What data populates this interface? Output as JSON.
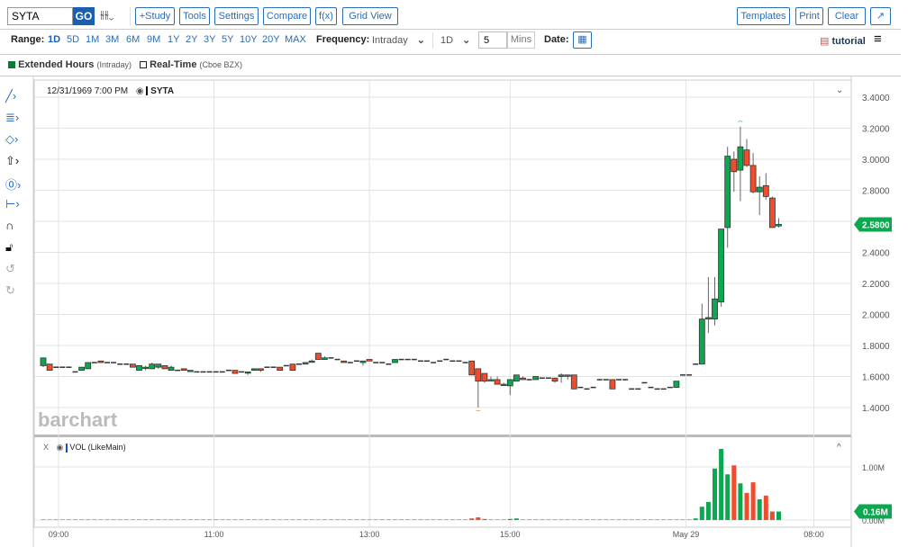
{
  "toolbar": {
    "symbol": "SYTA",
    "go": "GO",
    "buttons": [
      "+Study",
      "Tools",
      "Settings",
      "Compare",
      "f(x)",
      "Grid View"
    ],
    "right_buttons": [
      "Templates",
      "Print",
      "Clear"
    ]
  },
  "range": {
    "label": "Range:",
    "options": [
      "1D",
      "5D",
      "1M",
      "3M",
      "6M",
      "9M",
      "1Y",
      "2Y",
      "3Y",
      "5Y",
      "10Y",
      "20Y",
      "MAX"
    ],
    "selected": "1D"
  },
  "frequency": {
    "label": "Frequency:",
    "value": "Intraday",
    "period": "1D",
    "interval": "5",
    "unit": "Mins"
  },
  "date": {
    "label": "Date:"
  },
  "tutorial": "tutorial",
  "legend": {
    "extended": "Extended Hours",
    "extended_note": "(Intraday)",
    "realtime": "Real-Time",
    "realtime_note": "(Cboe BZX)"
  },
  "chart_header": {
    "datetime": "12/31/1969 7:00 PM",
    "symbol": "SYTA"
  },
  "volume_header": {
    "close": "X",
    "label": "VOL (LikeMain)"
  },
  "watermark": "barchart",
  "colors": {
    "up": "#0aa84f",
    "down": "#ef4d2d",
    "accent": "#2a6db8"
  },
  "chart_data": {
    "type": "candlestick",
    "ylim": [
      1.4,
      3.4
    ],
    "yticks": [
      "3.4000",
      "3.2000",
      "3.0000",
      "2.8000",
      "2.6000",
      "2.4000",
      "2.2000",
      "2.0000",
      "1.8000",
      "1.6000",
      "1.4000"
    ],
    "last_price": "2.5800",
    "last_price_value": 2.58,
    "volume_ticks": [
      "1.00M",
      "0.00M"
    ],
    "last_volume": "0.16M",
    "last_volume_value": 0.16,
    "xticks": [
      {
        "label": "09:00",
        "bar": 2.4
      },
      {
        "label": "11:00",
        "bar": 26.7
      },
      {
        "label": "13:00",
        "bar": 51
      },
      {
        "label": "15:00",
        "bar": 73
      },
      {
        "label": "May 29",
        "bar": 100.5
      },
      {
        "label": "08:00",
        "bar": 120.5
      }
    ],
    "candles": [
      [
        1.67,
        1.72,
        1.66,
        1.72,
        0.01
      ],
      [
        1.68,
        1.68,
        1.64,
        1.64,
        0.01
      ],
      [
        1.66,
        1.66,
        1.66,
        1.66,
        0.002
      ],
      [
        1.66,
        1.66,
        1.66,
        1.66,
        0.002
      ],
      [
        1.66,
        1.66,
        1.66,
        1.66,
        0.002
      ],
      [
        1.63,
        1.63,
        1.63,
        1.63,
        0.002
      ],
      [
        1.64,
        1.66,
        1.64,
        1.66,
        0.005
      ],
      [
        1.65,
        1.69,
        1.65,
        1.69,
        0.01
      ],
      [
        1.69,
        1.69,
        1.69,
        1.69,
        0.003
      ],
      [
        1.7,
        1.7,
        1.69,
        1.69,
        0.003
      ],
      [
        1.69,
        1.69,
        1.69,
        1.69,
        0.002
      ],
      [
        1.69,
        1.69,
        1.69,
        1.69,
        0.002
      ],
      [
        1.68,
        1.68,
        1.68,
        1.68,
        0.002
      ],
      [
        1.68,
        1.68,
        1.68,
        1.68,
        0.002
      ],
      [
        1.68,
        1.68,
        1.66,
        1.66,
        0.01
      ],
      [
        1.64,
        1.67,
        1.64,
        1.67,
        0.01
      ],
      [
        1.66,
        1.67,
        1.64,
        1.66,
        0.005
      ],
      [
        1.65,
        1.69,
        1.65,
        1.68,
        0.01
      ],
      [
        1.66,
        1.68,
        1.65,
        1.68,
        0.005
      ],
      [
        1.67,
        1.67,
        1.65,
        1.65,
        0.01
      ],
      [
        1.64,
        1.67,
        1.64,
        1.66,
        0.01
      ],
      [
        1.64,
        1.64,
        1.64,
        1.64,
        0.002
      ],
      [
        1.65,
        1.65,
        1.64,
        1.64,
        0.005
      ],
      [
        1.64,
        1.64,
        1.63,
        1.64,
        0.002
      ],
      [
        1.63,
        1.63,
        1.63,
        1.63,
        0.002
      ],
      [
        1.63,
        1.63,
        1.63,
        1.63,
        0.002
      ],
      [
        1.63,
        1.63,
        1.63,
        1.63,
        0.002
      ],
      [
        1.63,
        1.63,
        1.63,
        1.63,
        0.002
      ],
      [
        1.63,
        1.63,
        1.63,
        1.63,
        0.002
      ],
      [
        1.64,
        1.64,
        1.64,
        1.64,
        0.002
      ],
      [
        1.64,
        1.64,
        1.62,
        1.62,
        0.005
      ],
      [
        1.63,
        1.63,
        1.63,
        1.63,
        0.002
      ],
      [
        1.63,
        1.63,
        1.61,
        1.63,
        0.002
      ],
      [
        1.64,
        1.65,
        1.64,
        1.65,
        0.005
      ],
      [
        1.65,
        1.65,
        1.63,
        1.64,
        0.005
      ],
      [
        1.66,
        1.66,
        1.66,
        1.66,
        0.002
      ],
      [
        1.66,
        1.66,
        1.66,
        1.66,
        0.002
      ],
      [
        1.66,
        1.66,
        1.64,
        1.64,
        0.005
      ],
      [
        1.67,
        1.67,
        1.67,
        1.67,
        0.002
      ],
      [
        1.68,
        1.68,
        1.64,
        1.64,
        0.01
      ],
      [
        1.68,
        1.68,
        1.68,
        1.68,
        0.002
      ],
      [
        1.68,
        1.69,
        1.68,
        1.69,
        0.005
      ],
      [
        1.7,
        1.71,
        1.69,
        1.7,
        0.005
      ],
      [
        1.75,
        1.75,
        1.71,
        1.71,
        0.01
      ],
      [
        1.71,
        1.73,
        1.71,
        1.72,
        0.005
      ],
      [
        1.72,
        1.72,
        1.72,
        1.72,
        0.002
      ],
      [
        1.71,
        1.71,
        1.71,
        1.71,
        0.002
      ],
      [
        1.7,
        1.7,
        1.69,
        1.69,
        0.005
      ],
      [
        1.69,
        1.69,
        1.69,
        1.69,
        0.002
      ],
      [
        1.7,
        1.7,
        1.7,
        1.7,
        0.002
      ],
      [
        1.69,
        1.7,
        1.67,
        1.7,
        0.005
      ],
      [
        1.71,
        1.71,
        1.7,
        1.7,
        0.005
      ],
      [
        1.69,
        1.69,
        1.69,
        1.69,
        0.002
      ],
      [
        1.69,
        1.69,
        1.69,
        1.69,
        0.002
      ],
      [
        1.68,
        1.68,
        1.68,
        1.68,
        0.002
      ],
      [
        1.69,
        1.71,
        1.69,
        1.71,
        0.005
      ],
      [
        1.71,
        1.71,
        1.71,
        1.71,
        0.002
      ],
      [
        1.71,
        1.71,
        1.71,
        1.71,
        0.002
      ],
      [
        1.71,
        1.71,
        1.71,
        1.71,
        0.002
      ],
      [
        1.7,
        1.7,
        1.7,
        1.7,
        0.002
      ],
      [
        1.7,
        1.7,
        1.7,
        1.7,
        0.002
      ],
      [
        1.69,
        1.69,
        1.69,
        1.69,
        0.002
      ],
      [
        1.7,
        1.7,
        1.7,
        1.7,
        0.002
      ],
      [
        1.71,
        1.71,
        1.71,
        1.71,
        0.002
      ],
      [
        1.7,
        1.7,
        1.7,
        1.7,
        0.002
      ],
      [
        1.7,
        1.7,
        1.7,
        1.7,
        0.002
      ],
      [
        1.69,
        1.69,
        1.69,
        1.69,
        0.002
      ],
      [
        1.7,
        1.7,
        1.61,
        1.61,
        0.03
      ],
      [
        1.65,
        1.65,
        1.4,
        1.57,
        0.05
      ],
      [
        1.62,
        1.62,
        1.56,
        1.57,
        0.02
      ],
      [
        1.58,
        1.6,
        1.58,
        1.58,
        0.01
      ],
      [
        1.58,
        1.6,
        1.55,
        1.55,
        0.01
      ],
      [
        1.55,
        1.56,
        1.55,
        1.55,
        0.005
      ],
      [
        1.54,
        1.58,
        1.48,
        1.58,
        0.02
      ],
      [
        1.57,
        1.61,
        1.57,
        1.61,
        0.03
      ],
      [
        1.59,
        1.6,
        1.58,
        1.58,
        0.005
      ],
      [
        1.58,
        1.58,
        1.58,
        1.58,
        0.002
      ],
      [
        1.58,
        1.6,
        1.58,
        1.6,
        0.01
      ],
      [
        1.59,
        1.59,
        1.59,
        1.59,
        0.002
      ],
      [
        1.59,
        1.59,
        1.59,
        1.59,
        0.002
      ],
      [
        1.59,
        1.59,
        1.56,
        1.57,
        0.01
      ],
      [
        1.6,
        1.62,
        1.56,
        1.61,
        0.01
      ],
      [
        1.61,
        1.61,
        1.58,
        1.61,
        0.005
      ],
      [
        1.61,
        1.61,
        1.52,
        1.52,
        0.01
      ],
      [
        1.53,
        1.53,
        1.53,
        1.53,
        0.002
      ],
      [
        1.52,
        1.52,
        1.52,
        1.52,
        0.002
      ],
      [
        1.53,
        1.53,
        1.53,
        1.53,
        0.002
      ],
      [
        1.58,
        1.58,
        1.58,
        1.58,
        0.002
      ],
      [
        1.58,
        1.58,
        1.58,
        1.58,
        0.002
      ],
      [
        1.58,
        1.58,
        1.52,
        1.52,
        0.01
      ],
      [
        1.58,
        1.58,
        1.58,
        1.58,
        0.002
      ],
      [
        1.58,
        1.58,
        1.58,
        1.58,
        0.002
      ],
      [
        1.52,
        1.52,
        1.52,
        1.52,
        0.002
      ],
      [
        1.52,
        1.52,
        1.52,
        1.52,
        0.002
      ],
      [
        1.56,
        1.56,
        1.56,
        1.56,
        0.002
      ],
      [
        1.53,
        1.53,
        1.53,
        1.53,
        0.002
      ],
      [
        1.52,
        1.52,
        1.52,
        1.52,
        0.002
      ],
      [
        1.52,
        1.52,
        1.52,
        1.52,
        0.002
      ],
      [
        1.53,
        1.53,
        1.53,
        1.53,
        0.002
      ],
      [
        1.53,
        1.57,
        1.53,
        1.57,
        0.01
      ],
      [
        1.61,
        1.61,
        1.61,
        1.61,
        0.002
      ],
      [
        1.61,
        1.61,
        1.61,
        1.61,
        0.002
      ],
      [
        1.68,
        1.68,
        1.68,
        1.68,
        0.03
      ],
      [
        1.68,
        2.07,
        1.68,
        1.97,
        0.25
      ],
      [
        1.97,
        2.24,
        1.88,
        1.98,
        0.34
      ],
      [
        1.97,
        2.24,
        1.93,
        2.1,
        0.97
      ],
      [
        2.08,
        2.55,
        2.05,
        2.55,
        1.34
      ],
      [
        2.56,
        3.08,
        2.43,
        3.02,
        0.86
      ],
      [
        3.0,
        3.05,
        2.79,
        2.92,
        1.03
      ],
      [
        2.93,
        3.21,
        2.73,
        3.08,
        0.69
      ],
      [
        3.06,
        3.13,
        2.95,
        2.96,
        0.51
      ],
      [
        2.96,
        3.04,
        2.78,
        2.79,
        0.71
      ],
      [
        2.79,
        2.89,
        2.64,
        2.82,
        0.39
      ],
      [
        2.83,
        2.91,
        2.74,
        2.76,
        0.46
      ],
      [
        2.75,
        2.76,
        2.56,
        2.56,
        0.16
      ],
      [
        2.57,
        2.62,
        2.56,
        2.58,
        0.16
      ]
    ]
  }
}
